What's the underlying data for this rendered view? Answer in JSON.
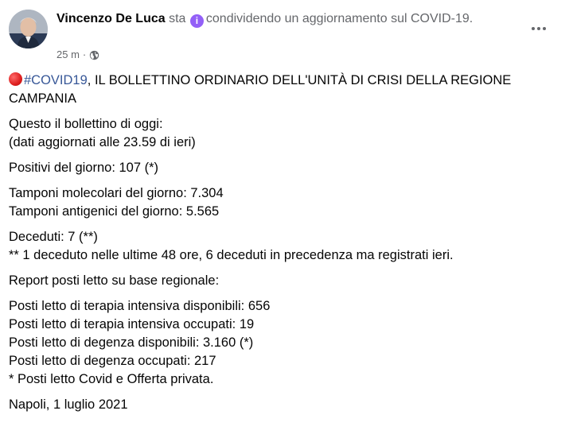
{
  "post": {
    "author": "Vincenzo De Luca",
    "sharing_prefix": "sta",
    "sharing_text": "condividendo un aggiornamento sul COVID-19.",
    "time": "25 m",
    "separator": "·",
    "more_icon": "more-horizontal-icon",
    "privacy_icon": "globe-icon"
  },
  "body": {
    "headline": {
      "emoji": "red-circle",
      "hashtag": "#COVID19",
      "text": ", IL BOLLETTINO ORDINARIO DELL'UNITÀ DI CRISI DELLA REGIONE CAMPANIA"
    },
    "intro_1": "Questo il bollettino di oggi:",
    "intro_2": "(dati aggiornati alle 23.59 di ieri)",
    "positivi": "Positivi del giorno: 107 (*)",
    "tamponi_molecolari": "Tamponi molecolari del giorno: 7.304",
    "tamponi_antigenici": "Tamponi antigenici del giorno: 5.565",
    "deceduti": "Deceduti: 7 (**)",
    "deceduti_note": "** 1 deceduto nelle ultime 48 ore, 6 deceduti in precedenza ma registrati ieri.",
    "report_title": "Report posti letto su base regionale:",
    "ti_disponibili": "Posti letto di terapia intensiva disponibili: 656",
    "ti_occupati": "Posti letto di terapia intensiva occupati: 19",
    "degenza_disponibili": "Posti letto di degenza disponibili: 3.160 (*)",
    "degenza_occupati": "Posti letto di degenza occupati: 217",
    "posti_note": "* Posti letto Covid e Offerta privata.",
    "signoff": "Napoli, 1 luglio 2021"
  },
  "colors": {
    "link": "#385898",
    "muted": "#65676b",
    "feeling_icon": "#9360f7"
  }
}
